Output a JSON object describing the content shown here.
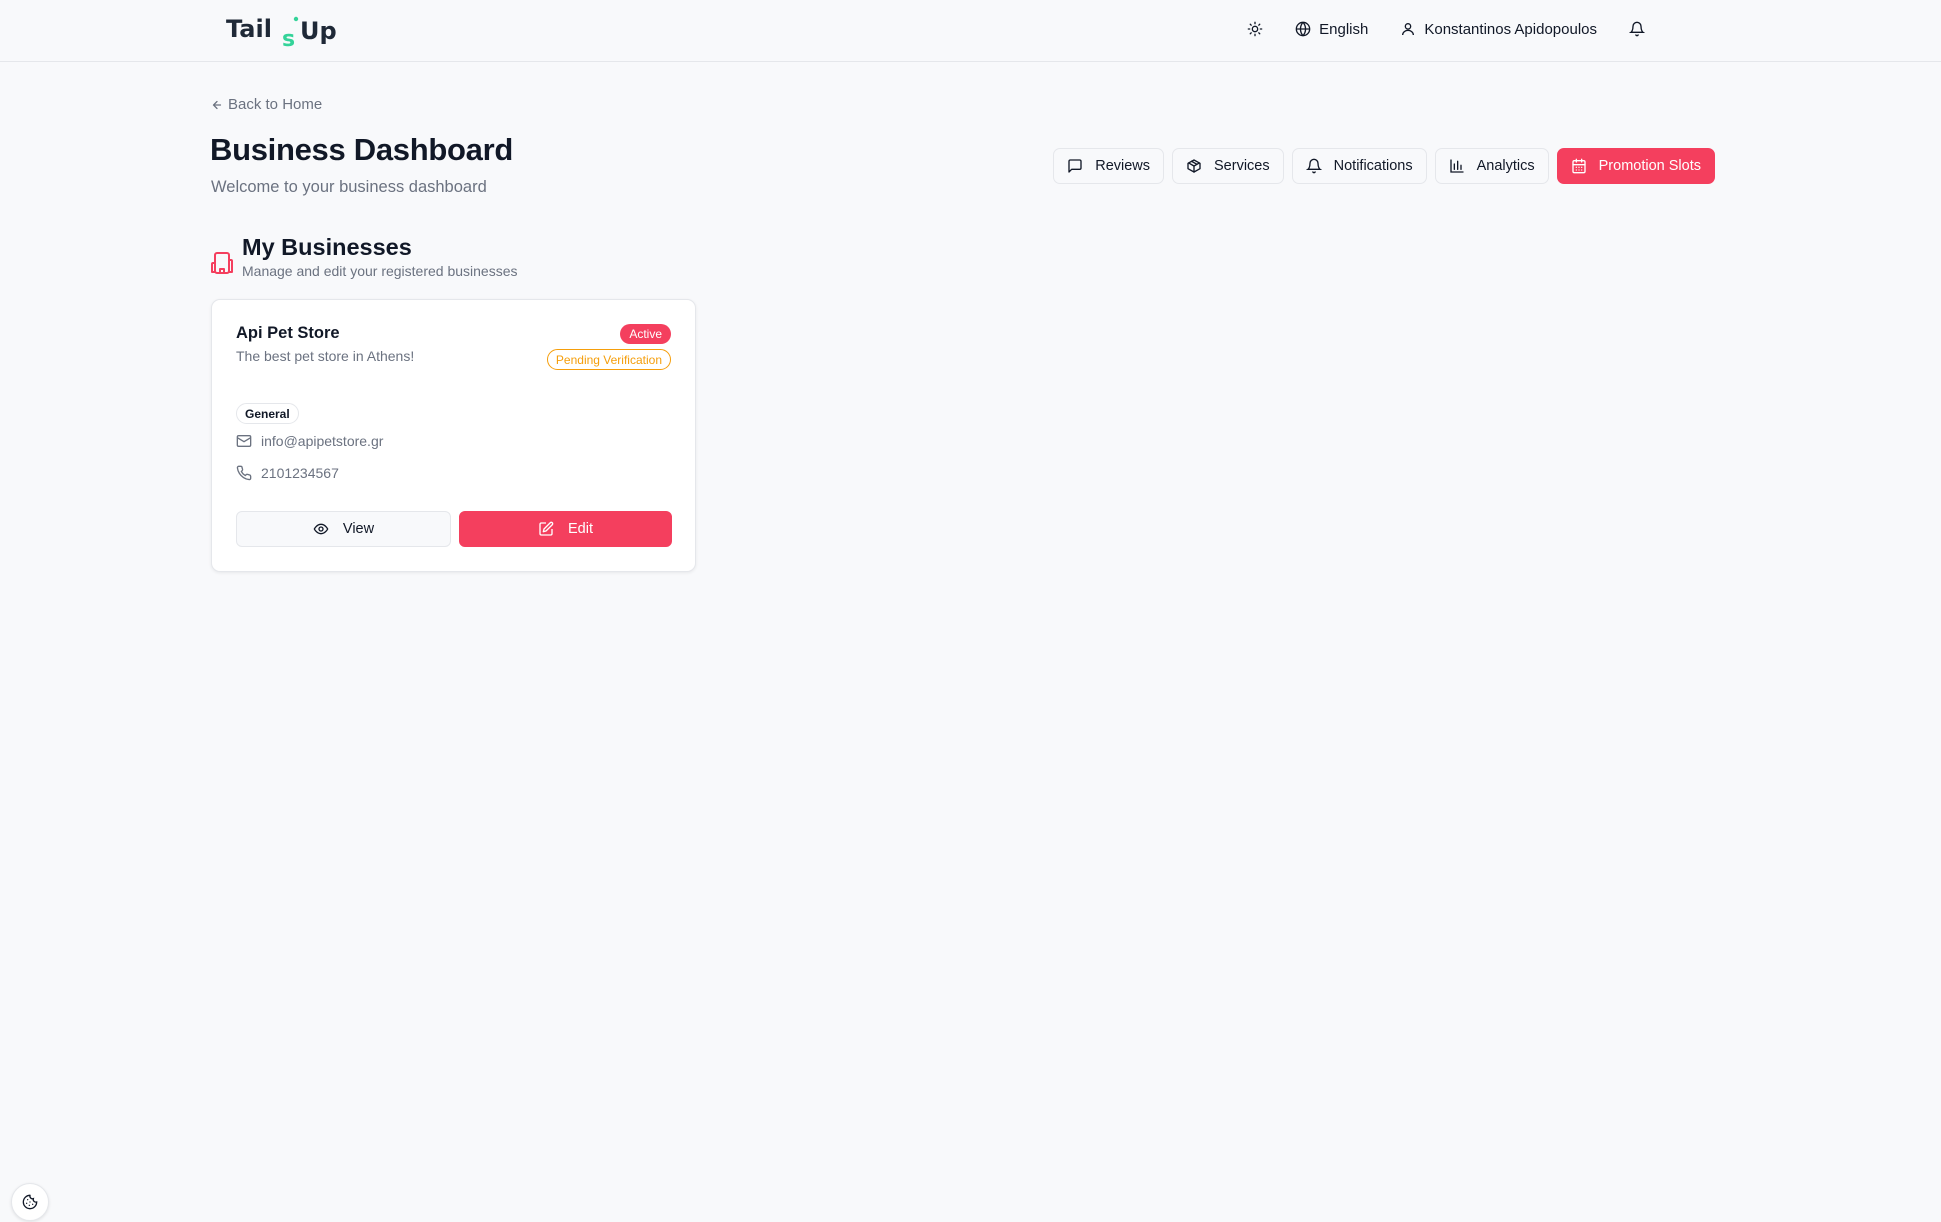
{
  "brand": {
    "logo_text_part1": "Tail",
    "logo_text_part2": "s",
    "logo_text_part3": "Up",
    "logo_accent_color": "#34d399",
    "logo_dark_color": "#1f2937"
  },
  "topbar": {
    "theme_icon": "sun-icon",
    "language_label": "English",
    "user_name": "Konstantinos Apidopoulos",
    "notification_icon": "bell-icon"
  },
  "page": {
    "back_link": "Back to Home",
    "title": "Business Dashboard",
    "subtitle": "Welcome to your business dashboard"
  },
  "tabs": [
    {
      "label": "Reviews",
      "icon": "message-square-icon",
      "active": false
    },
    {
      "label": "Services",
      "icon": "package-icon",
      "active": false
    },
    {
      "label": "Notifications",
      "icon": "bell-icon",
      "active": false
    },
    {
      "label": "Analytics",
      "icon": "bar-chart-icon",
      "active": false
    },
    {
      "label": "Promotion Slots",
      "icon": "calendar-icon",
      "active": true
    }
  ],
  "section": {
    "title": "My Businesses",
    "subtitle": "Manage and edit your registered businesses",
    "icon": "building-icon"
  },
  "businesses": [
    {
      "name": "Api Pet Store",
      "description": "The best pet store in Athens!",
      "status_badge": "Active",
      "verification_badge": "Pending Verification",
      "category": "General",
      "email": "info@apipetstore.gr",
      "phone": "2101234567",
      "view_label": "View",
      "edit_label": "Edit"
    }
  ],
  "colors": {
    "accent": "#f43f5e",
    "warning": "#f59e0b",
    "muted_text": "#6b7280",
    "background": "#f8f9fb"
  },
  "cookie_icon": "cookie-icon"
}
